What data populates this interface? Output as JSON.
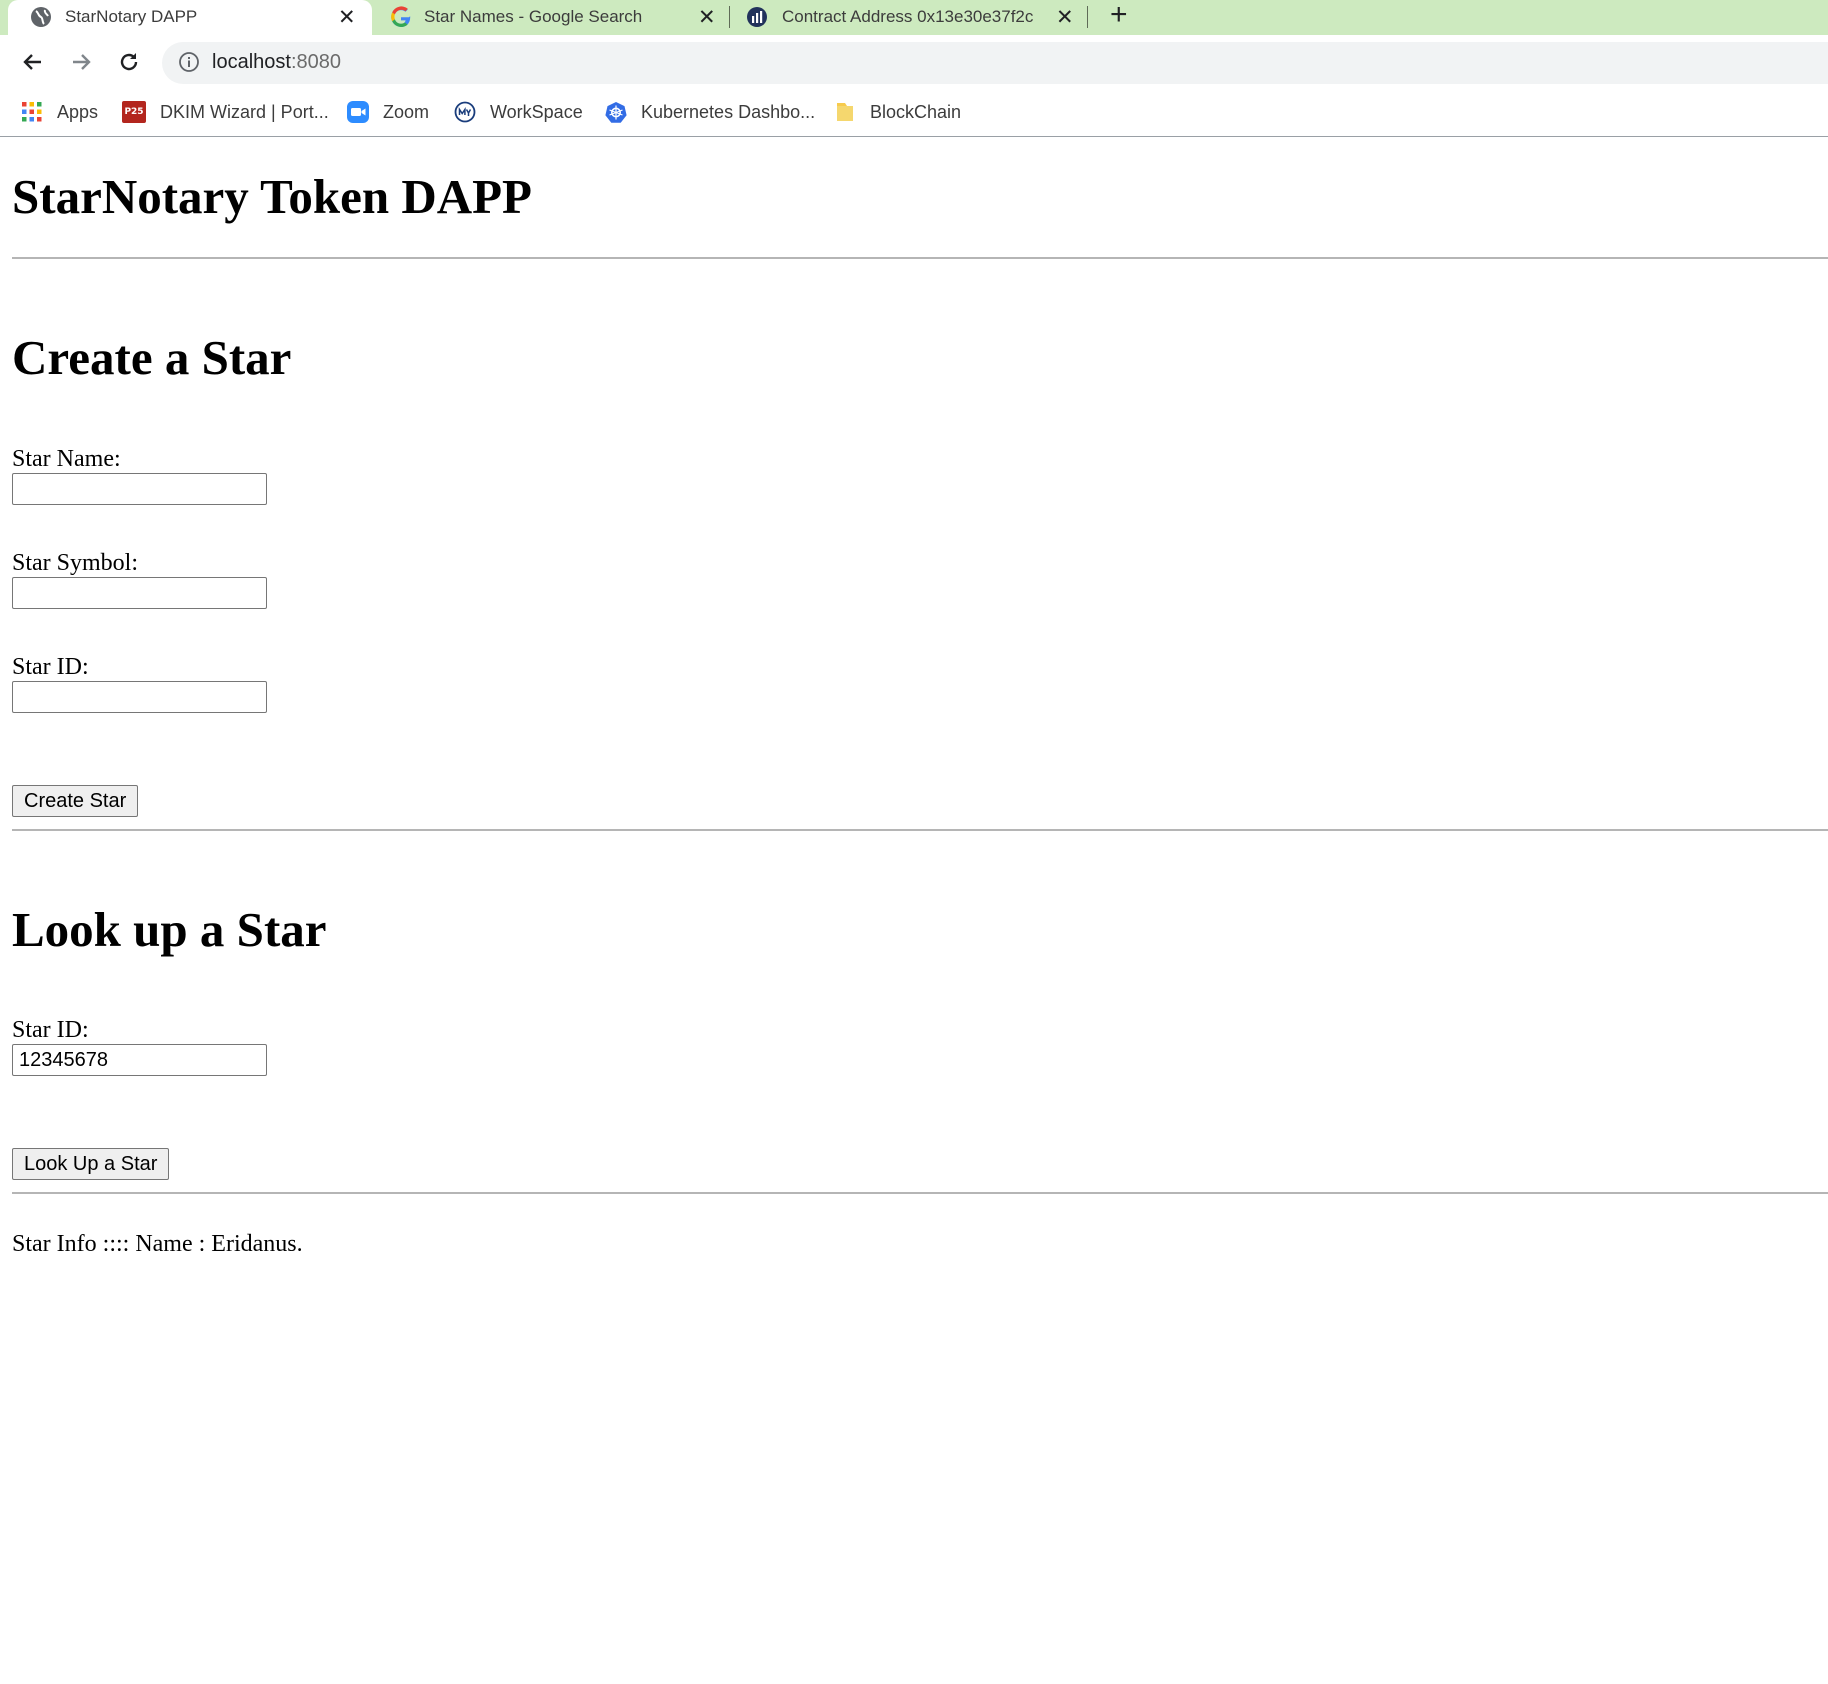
{
  "browser": {
    "tabs": [
      {
        "title": "StarNotary DAPP",
        "icon": "globe-icon",
        "active": true
      },
      {
        "title": "Star Names - Google Search",
        "icon": "google-icon",
        "active": false
      },
      {
        "title": "Contract Address 0x13e30e37f2c",
        "icon": "etherscan-icon",
        "active": false
      }
    ],
    "new_tab_glyph": "+",
    "close_glyph": "✕",
    "url_host": "localhost",
    "url_port": ":8080",
    "bookmarks": [
      {
        "label": "Apps",
        "icon": "apps-grid-icon"
      },
      {
        "label": "DKIM Wizard | Port...",
        "icon": "p25-icon",
        "icon_text": "P25"
      },
      {
        "label": "Zoom",
        "icon": "zoom-icon"
      },
      {
        "label": "WorkSpace",
        "icon": "workspace-icon"
      },
      {
        "label": "Kubernetes Dashbo...",
        "icon": "kubernetes-icon"
      },
      {
        "label": "BlockChain",
        "icon": "folder-icon"
      }
    ]
  },
  "page": {
    "title": "StarNotary Token DAPP",
    "create": {
      "heading": "Create a Star",
      "name_label": "Star Name:",
      "name_value": "",
      "symbol_label": "Star Symbol:",
      "symbol_value": "",
      "id_label": "Star ID:",
      "id_value": "",
      "button": "Create Star"
    },
    "lookup": {
      "heading": "Look up a Star",
      "id_label": "Star ID:",
      "id_value": "12345678",
      "button": "Look Up a Star"
    },
    "status": "Star Info :::: Name : Eridanus."
  },
  "colors": {
    "tabstrip": "#cdeabf",
    "omnibox": "#f1f3f4"
  }
}
